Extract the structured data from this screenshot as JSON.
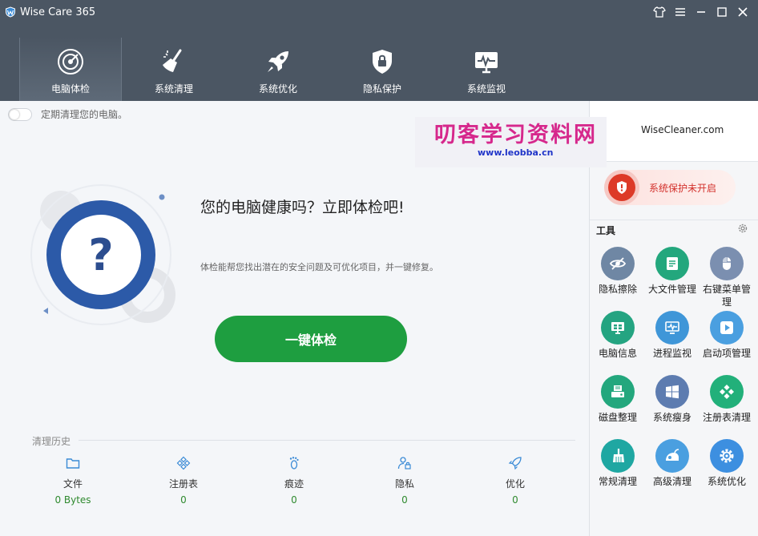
{
  "window": {
    "title": "Wise Care 365"
  },
  "nav": [
    {
      "label": "电脑体检",
      "active": true
    },
    {
      "label": "系统清理"
    },
    {
      "label": "系统优化"
    },
    {
      "label": "隐私保护"
    },
    {
      "label": "系统监视"
    }
  ],
  "main": {
    "schedule_text": "定期清理您的电脑。",
    "hero_title": "您的电脑健康吗？立即体检吧!",
    "hero_desc": "体检能帮您找出潜在的安全问题及可优化项目，并一键修复。",
    "check_button": "一键体检"
  },
  "history": {
    "title": "清理历史",
    "items": [
      {
        "label": "文件",
        "value": "0 Bytes"
      },
      {
        "label": "注册表",
        "value": "0"
      },
      {
        "label": "痕迹",
        "value": "0"
      },
      {
        "label": "隐私",
        "value": "0"
      },
      {
        "label": "优化",
        "value": "0"
      }
    ]
  },
  "sidebar": {
    "watermark_title": "叨客学习资料网",
    "watermark_url": "www.leobba.cn",
    "site_link": "WiseCleaner.com",
    "protection_status": "系统保护未开启",
    "tools_title": "工具",
    "tools": [
      {
        "label": "隐私擦除",
        "icon": "eye-off-icon",
        "color": "#6f87a4"
      },
      {
        "label": "大文件管理",
        "icon": "file-list-icon",
        "color": "#23a77d"
      },
      {
        "label": "右键菜单管理",
        "icon": "mouse-icon",
        "color": "#7b8fb0"
      },
      {
        "label": "电脑信息",
        "icon": "pc-info-icon",
        "color": "#24a481"
      },
      {
        "label": "进程监视",
        "icon": "monitor-icon",
        "color": "#3f96d8"
      },
      {
        "label": "启动项管理",
        "icon": "play-icon",
        "color": "#4a9fe0"
      },
      {
        "label": "磁盘整理",
        "icon": "disk-icon",
        "color": "#23a77d"
      },
      {
        "label": "系统瘦身",
        "icon": "windows-icon",
        "color": "#5d7cb0"
      },
      {
        "label": "注册表清理",
        "icon": "registry-icon",
        "color": "#22b07a"
      },
      {
        "label": "常规清理",
        "icon": "broom-icon",
        "color": "#1fa7a2"
      },
      {
        "label": "高级清理",
        "icon": "vacuum-icon",
        "color": "#4a9fe0"
      },
      {
        "label": "系统优化",
        "icon": "gear-icon",
        "color": "#3d8fe0"
      }
    ]
  },
  "colors": {
    "accent_green": "#1e9e40",
    "header_bg": "#4b5663",
    "warning_red": "#dd3a28"
  }
}
